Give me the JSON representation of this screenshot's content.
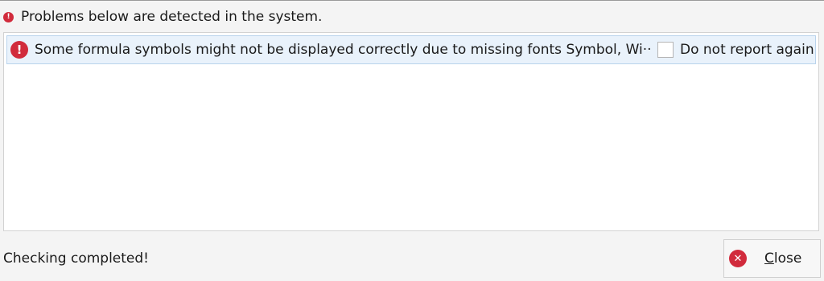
{
  "header": {
    "icon": "error-icon",
    "text": "Problems below are detected in the system."
  },
  "problems": [
    {
      "icon": "error-icon",
      "text": "Some formula symbols might not be displayed correctly due to missing fonts Symbol, Wi···",
      "checkbox_label": "Do not report again",
      "checked": false
    }
  ],
  "status": {
    "text": "Checking completed!"
  },
  "close_button": {
    "icon": "close-icon",
    "mnemonic": "C",
    "label_rest": "lose"
  },
  "colors": {
    "error": "#d12b3c",
    "row_highlight": "#e9f2fb"
  }
}
